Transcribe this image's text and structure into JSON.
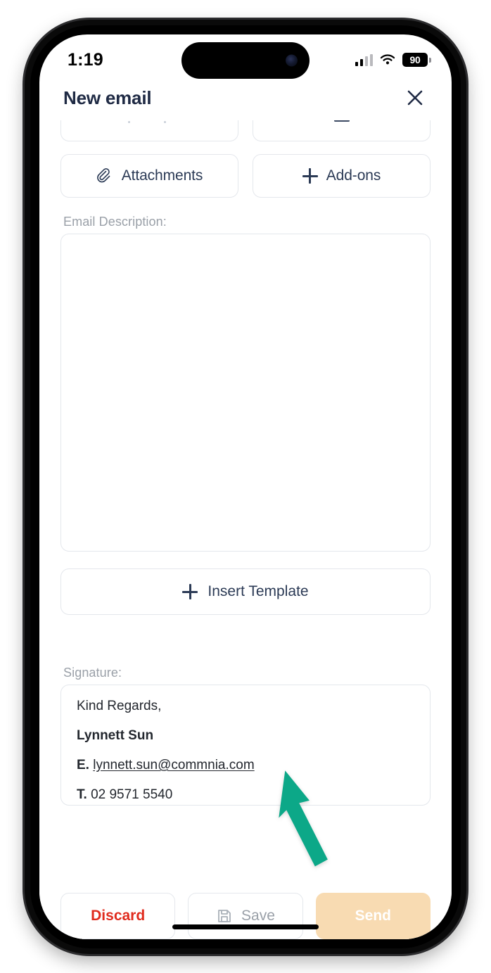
{
  "status_bar": {
    "time": "1:19",
    "battery_level": "90",
    "signal_icon": "cellular-signal-icon",
    "wifi_icon": "wifi-icon",
    "battery_icon": "battery-icon"
  },
  "header": {
    "title": "New email",
    "close_icon": "close-icon"
  },
  "compose": {
    "attachments": {
      "label": "Attachments",
      "icon": "paperclip-icon"
    },
    "addons": {
      "label": "Add-ons",
      "icon": "plus-icon"
    },
    "description": {
      "label": "Email Description:",
      "value": "",
      "placeholder": ""
    },
    "insert_template": {
      "label": "Insert Template",
      "icon": "plus-icon"
    },
    "signature": {
      "label": "Signature:",
      "lines": [
        {
          "text": "Kind Regards,"
        },
        {
          "text": "Lynnett Sun"
        },
        {
          "prefix": "E.",
          "text": "lynnett.sun@commnia.com"
        },
        {
          "prefix": "T.",
          "text": "02 9571 5540"
        }
      ]
    }
  },
  "action_bar": {
    "discard_label": "Discard",
    "save_label": "Save",
    "save_icon": "floppy-disk-icon",
    "send_label": "Send"
  },
  "colors": {
    "accent_send": "#f8dbb2",
    "discard_red": "#e02b1d",
    "text_navy": "#2b3a55",
    "muted_gray": "#9aa0a8",
    "border_gray": "#e4e7ec",
    "arrow_green": "#0ca888"
  }
}
